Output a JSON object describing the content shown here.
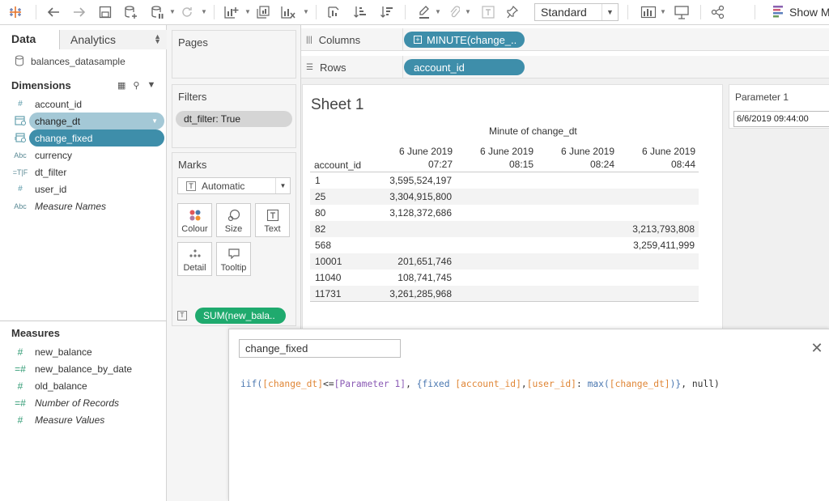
{
  "toolbar": {
    "mark_type": "Standard",
    "show_me": "Show Me",
    "icons": [
      "tableau-logo-icon",
      "undo-icon",
      "redo-icon",
      "save-icon",
      "new-datasource-icon",
      "pause-updates-icon",
      "refresh-icon",
      "new-worksheet-icon",
      "duplicate-sheet-icon",
      "clear-sheet-icon",
      "swap-axes-icon",
      "sort-ascending-icon",
      "sort-descending-icon",
      "highlight-icon",
      "paperclip-icon",
      "labels-icon",
      "pin-icon",
      "chart-view-icon",
      "presentation-icon",
      "share-icon"
    ]
  },
  "data_pane": {
    "tab_data": "Data",
    "tab_analytics": "Analytics",
    "datasource": "balances_datasample",
    "dimensions_header": "Dimensions",
    "dimensions": [
      {
        "name": "account_id",
        "type": "#"
      },
      {
        "name": "change_dt",
        "type": "date"
      },
      {
        "name": "change_fixed",
        "type": "date"
      },
      {
        "name": "currency",
        "type": "Abc"
      },
      {
        "name": "dt_filter",
        "type": "T|F"
      },
      {
        "name": "user_id",
        "type": "#"
      },
      {
        "name": "Measure Names",
        "type": "Abc"
      }
    ],
    "measures_header": "Measures",
    "measures": [
      {
        "name": "new_balance",
        "type": "#"
      },
      {
        "name": "new_balance_by_date",
        "type": "=#"
      },
      {
        "name": "old_balance",
        "type": "#"
      },
      {
        "name": "Number of Records",
        "type": "=#"
      },
      {
        "name": "Measure Values",
        "type": "#"
      }
    ]
  },
  "shelves": {
    "pages_title": "Pages",
    "filters_title": "Filters",
    "filter_pill": "dt_filter: True",
    "marks_title": "Marks",
    "marks_type": "Automatic",
    "marks_buttons": [
      "Colour",
      "Size",
      "Text",
      "Detail",
      "Tooltip"
    ],
    "marks_pill": "SUM(new_bala..",
    "columns_label": "Columns",
    "columns_pill": "MINUTE(change_..",
    "rows_label": "Rows",
    "rows_pill": "account_id"
  },
  "sheet": {
    "title": "Sheet 1",
    "column_header_title": "Minute of change_dt",
    "row_header_title": "account_id",
    "columns": [
      {
        "date": "6 June 2019",
        "time": "07:27"
      },
      {
        "date": "6 June 2019",
        "time": "08:15"
      },
      {
        "date": "6 June 2019",
        "time": "08:24"
      },
      {
        "date": "6 June 2019",
        "time": "08:44"
      }
    ],
    "rows": [
      {
        "id": "1",
        "values": [
          "3,595,524,197",
          "",
          "",
          ""
        ]
      },
      {
        "id": "25",
        "values": [
          "3,304,915,800",
          "",
          "",
          ""
        ]
      },
      {
        "id": "80",
        "values": [
          "3,128,372,686",
          "",
          "",
          ""
        ]
      },
      {
        "id": "82",
        "values": [
          "",
          "",
          "",
          "3,213,793,808"
        ]
      },
      {
        "id": "568",
        "values": [
          "",
          "",
          "",
          "3,259,411,999"
        ]
      },
      {
        "id": "10001",
        "values": [
          "201,651,746",
          "",
          "",
          ""
        ]
      },
      {
        "id": "11040",
        "values": [
          "108,741,745",
          "",
          "",
          ""
        ]
      },
      {
        "id": "11731",
        "values": [
          "3,261,285,968",
          "",
          "",
          ""
        ]
      }
    ]
  },
  "parameter": {
    "title": "Parameter 1",
    "value": "6/6/2019 09:44:00"
  },
  "calc_editor": {
    "name": "change_fixed",
    "formula_parts": [
      [
        "fn",
        "iif("
      ],
      [
        "field",
        "[change_dt]"
      ],
      [
        "txt",
        "<="
      ],
      [
        "param",
        "[Parameter 1]"
      ],
      [
        "txt",
        ", "
      ],
      [
        "br",
        "{fixed "
      ],
      [
        "field",
        "[account_id]"
      ],
      [
        "txt",
        ","
      ],
      [
        "field",
        "[user_id]"
      ],
      [
        "txt",
        ": "
      ],
      [
        "fn",
        "max("
      ],
      [
        "field",
        "[change_dt]"
      ],
      [
        "fn",
        ")"
      ],
      [
        "br",
        "}"
      ],
      [
        "txt",
        ", null)"
      ]
    ]
  }
}
